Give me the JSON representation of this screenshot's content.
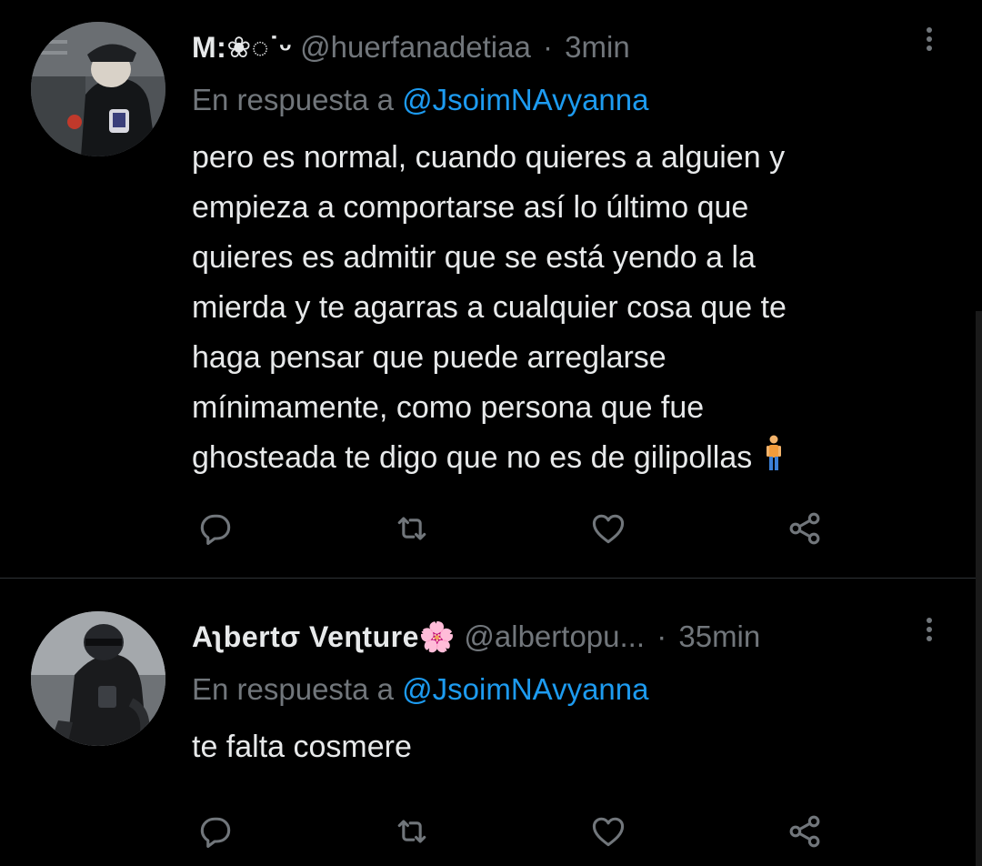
{
  "tweets": [
    {
      "display_name": "M:❀◌˙ᵕ",
      "handle": "@huerfanadetiaa",
      "separator": "·",
      "time": "3min",
      "reply_prefix": "En respuesta a",
      "reply_handle": "@JsoimNAvyanna",
      "text": "pero es normal, cuando quieres a alguien y\nempieza a comportarse así lo último que\nquieres es admitir que se está yendo a la\nmierda y te agarras a cualquier cosa que te\nhaga pensar que puede arreglarse\nmínimamente, como persona que fue\nghosteada te digo que no es de gilipollas",
      "emoji": "person-standing"
    },
    {
      "display_name": "Aʅbertσ Veɳture🌸",
      "handle": "@albertopu...",
      "separator": "·",
      "time": "35min",
      "reply_prefix": "En respuesta a",
      "reply_handle": "@JsoimNAvyanna",
      "text": "te falta cosmere"
    }
  ],
  "icons": {
    "reply": "comment-bubble-icon",
    "retweet": "retweet-icon",
    "like": "heart-icon",
    "share": "share-icon",
    "more": "more-vertical-icon"
  },
  "colors": {
    "background": "#000000",
    "text": "#e7e9ea",
    "muted": "#71767b",
    "link": "#1d9bf0",
    "divider": "#2f3336"
  }
}
